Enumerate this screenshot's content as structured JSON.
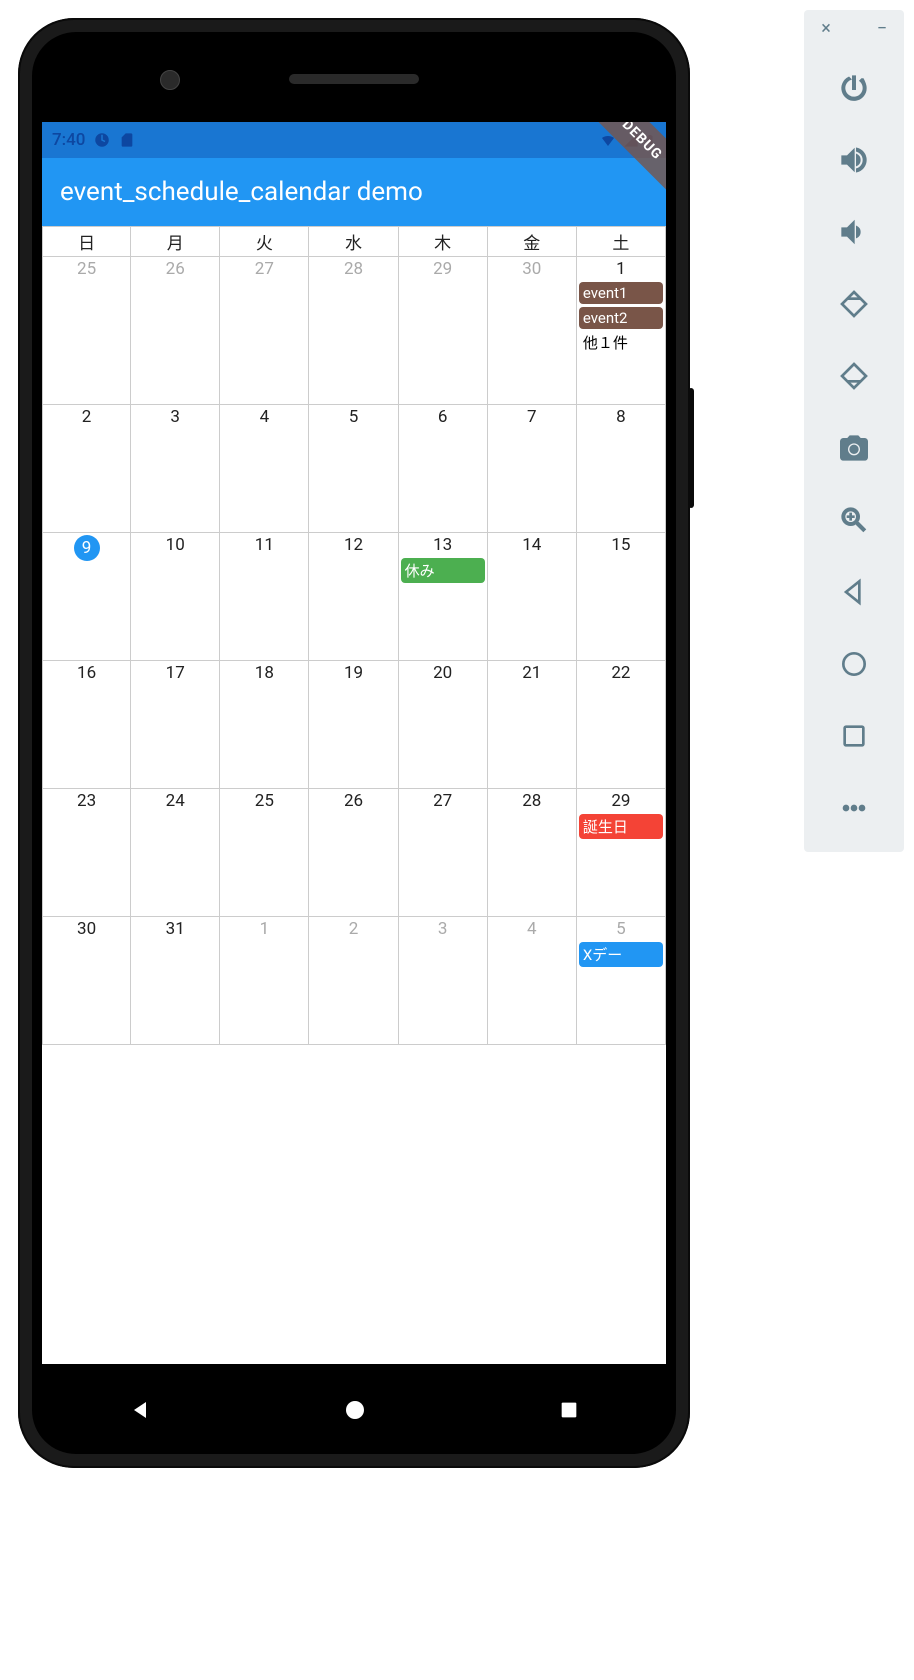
{
  "emulator": {
    "close": "×",
    "minimize": "−"
  },
  "status_bar": {
    "time": "7:40"
  },
  "app": {
    "title": "event_schedule_calendar demo",
    "debug": "DEBUG"
  },
  "calendar": {
    "weekdays": [
      "日",
      "月",
      "火",
      "水",
      "木",
      "金",
      "土"
    ],
    "today": "9",
    "weeks": [
      [
        {
          "n": "25",
          "o": true,
          "ev": []
        },
        {
          "n": "26",
          "o": true,
          "ev": []
        },
        {
          "n": "27",
          "o": true,
          "ev": []
        },
        {
          "n": "28",
          "o": true,
          "ev": []
        },
        {
          "n": "29",
          "o": true,
          "ev": []
        },
        {
          "n": "30",
          "o": true,
          "ev": []
        },
        {
          "n": "1",
          "o": false,
          "ev": [
            {
              "t": "event1",
              "c": "#795548"
            },
            {
              "t": "event2",
              "c": "#795548"
            }
          ],
          "more": "他１件"
        }
      ],
      [
        {
          "n": "2",
          "o": false,
          "ev": []
        },
        {
          "n": "3",
          "o": false,
          "ev": []
        },
        {
          "n": "4",
          "o": false,
          "ev": []
        },
        {
          "n": "5",
          "o": false,
          "ev": []
        },
        {
          "n": "6",
          "o": false,
          "ev": []
        },
        {
          "n": "7",
          "o": false,
          "ev": []
        },
        {
          "n": "8",
          "o": false,
          "ev": []
        }
      ],
      [
        {
          "n": "9",
          "o": false,
          "today": true,
          "ev": []
        },
        {
          "n": "10",
          "o": false,
          "ev": []
        },
        {
          "n": "11",
          "o": false,
          "ev": []
        },
        {
          "n": "12",
          "o": false,
          "ev": []
        },
        {
          "n": "13",
          "o": false,
          "ev": [
            {
              "t": "休み",
              "c": "#4caf50"
            }
          ]
        },
        {
          "n": "14",
          "o": false,
          "ev": []
        },
        {
          "n": "15",
          "o": false,
          "ev": []
        }
      ],
      [
        {
          "n": "16",
          "o": false,
          "ev": []
        },
        {
          "n": "17",
          "o": false,
          "ev": []
        },
        {
          "n": "18",
          "o": false,
          "ev": []
        },
        {
          "n": "19",
          "o": false,
          "ev": []
        },
        {
          "n": "20",
          "o": false,
          "ev": []
        },
        {
          "n": "21",
          "o": false,
          "ev": []
        },
        {
          "n": "22",
          "o": false,
          "ev": []
        }
      ],
      [
        {
          "n": "23",
          "o": false,
          "ev": []
        },
        {
          "n": "24",
          "o": false,
          "ev": []
        },
        {
          "n": "25",
          "o": false,
          "ev": []
        },
        {
          "n": "26",
          "o": false,
          "ev": []
        },
        {
          "n": "27",
          "o": false,
          "ev": []
        },
        {
          "n": "28",
          "o": false,
          "ev": []
        },
        {
          "n": "29",
          "o": false,
          "ev": [
            {
              "t": "誕生日",
              "c": "#f44336"
            }
          ]
        }
      ],
      [
        {
          "n": "30",
          "o": false,
          "ev": []
        },
        {
          "n": "31",
          "o": false,
          "ev": []
        },
        {
          "n": "1",
          "o": true,
          "ev": []
        },
        {
          "n": "2",
          "o": true,
          "ev": []
        },
        {
          "n": "3",
          "o": true,
          "ev": []
        },
        {
          "n": "4",
          "o": true,
          "ev": []
        },
        {
          "n": "5",
          "o": true,
          "ev": [
            {
              "t": "Xデー",
              "c": "#2196f3"
            }
          ]
        }
      ]
    ]
  }
}
